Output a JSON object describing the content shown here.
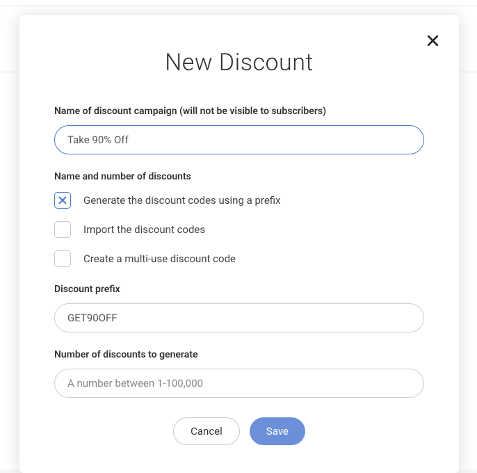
{
  "modal": {
    "title": "New Discount",
    "close_icon": "✕",
    "campaign_name": {
      "label": "Name of discount campaign (will not be visible to subscribers)",
      "value": "Take 90% Off"
    },
    "discount_method": {
      "label": "Name and number of discounts",
      "options": [
        {
          "label": "Generate the discount codes using a prefix",
          "checked": true
        },
        {
          "label": "Import the discount codes",
          "checked": false
        },
        {
          "label": "Create a multi-use discount code",
          "checked": false
        }
      ]
    },
    "prefix": {
      "label": "Discount prefix",
      "value": "GET90OFF"
    },
    "number": {
      "label": "Number of discounts to generate",
      "placeholder": "A number between 1-100,000"
    },
    "buttons": {
      "cancel": "Cancel",
      "save": "Save"
    }
  }
}
